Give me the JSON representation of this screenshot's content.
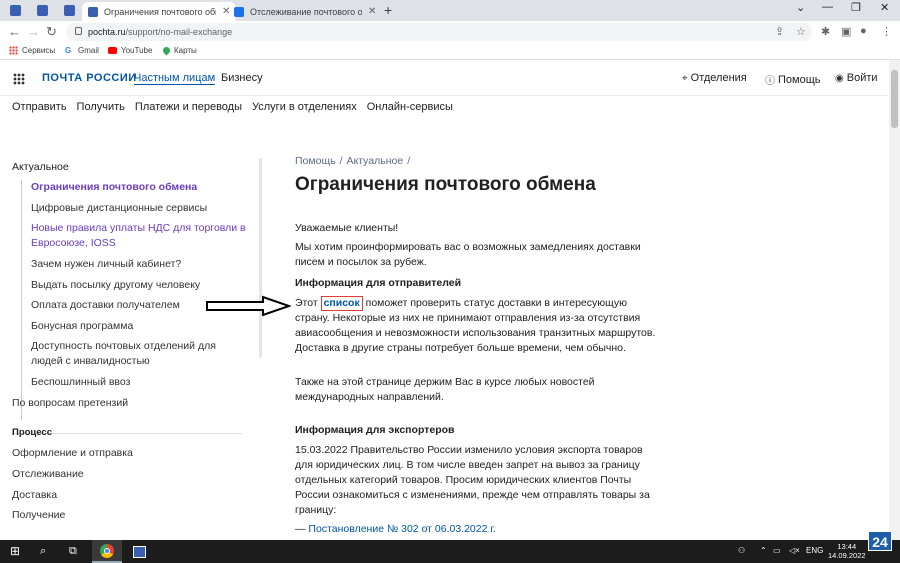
{
  "browser": {
    "tabs": [
      {
        "title": "Ограничения почтового обмен"
      },
      {
        "title": "Отслеживание почтового отпр"
      }
    ],
    "url_host": "pochta.ru",
    "url_path": "/support/no-mail-exchange",
    "bookmarks": [
      "Сервисы",
      "Gmail",
      "YouTube",
      "Карты"
    ]
  },
  "header": {
    "logo": "ПОЧТА РОССИИ",
    "segments": [
      "Частным лицам",
      "Бизнесу"
    ],
    "right": [
      "Отделения",
      "Помощь",
      "Войти"
    ]
  },
  "subnav": [
    "Отправить",
    "Получить",
    "Платежи и переводы",
    "Услуги в отделениях",
    "Онлайн-сервисы"
  ],
  "sidebar": {
    "section_current": "Актуальное",
    "items": [
      "Ограничения почтового обмена",
      "Цифровые дистанционные сервисы",
      "Новые правила уплаты НДС для торговли в Евросоюзе, IOSS",
      "Зачем нужен личный кабинет?",
      "Выдать посылку другому человеку",
      "Оплата доставки получателем",
      "Бонусная программа",
      "Доступность почтовых отделений для людей с инвалидностью",
      "Беспошлинный ввоз"
    ],
    "claims": "По вопросам претензий",
    "process_title": "Процесс",
    "process_items": [
      "Оформление и отправка",
      "Отслеживание",
      "Доставка",
      "Получение"
    ]
  },
  "main": {
    "breadcrumbs": [
      "Помощь",
      "/",
      "Актуальное",
      "/"
    ],
    "title": "Ограничения почтового обмена",
    "greeting": "Уважаемые клиенты!",
    "intro": "Мы хотим проинформировать вас о возможных замедлениях доставки писем и посылок за рубеж.",
    "senders_title": "Информация для отправителей",
    "senders_pre": "Этот ",
    "senders_link": "список",
    "senders_post": " поможет проверить статус доставки в интересующую страну. Некоторые из них не принимают отправления из-за отсутствия авиасообщения и невозможности использования транзитных маршрутов. Доставка в другие страны потребует больше времени, чем обычно.",
    "news": "Также на этой странице держим Вас в курсе любых новостей международных направлений.",
    "exporters_title": "Информация для экспортеров",
    "exporters_text": "15.03.2022 Правительство России изменило условия экспорта товаров для юридических лиц. В том числе введен запрет на вывоз за границу отдельных категорий товаров. Просим юридических клиентов Почты России ознакомиться с изменениями, прежде чем отправлять товары за границу:",
    "doc_dash": "—",
    "doc_link": "Постановление № 302 от 06.03.2022 г."
  },
  "taskbar": {
    "lang": "ENG",
    "time": "13:44",
    "date": "14.09.2022",
    "badge": "24"
  },
  "colors": {
    "brand": "#0055a6",
    "sidebar_active": "#6b3dc0",
    "link_outline": "#e53935"
  }
}
